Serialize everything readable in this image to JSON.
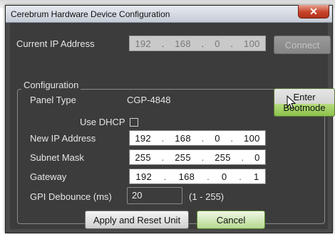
{
  "window": {
    "title": "Cerebrum Hardware Device Configuration"
  },
  "current_ip": {
    "label": "Current IP Address",
    "octets": [
      "192",
      "168",
      "0",
      "100"
    ],
    "connect_label": "Connect"
  },
  "configuration": {
    "group_title": "Configuration",
    "panel_type_label": "Panel Type",
    "panel_type_value": "CGP-4848",
    "enter_bootmode_line1": "Enter",
    "enter_bootmode_line2": "Bootmode",
    "use_dhcp_label": "Use DHCP",
    "use_dhcp_checked": false,
    "new_ip_label": "New IP Address",
    "new_ip_octets": [
      "192",
      "168",
      "0",
      "100"
    ],
    "subnet_label": "Subnet Mask",
    "subnet_octets": [
      "255",
      "255",
      "255",
      "0"
    ],
    "gateway_label": "Gateway",
    "gateway_octets": [
      "192",
      "168",
      "0",
      "1"
    ],
    "debounce_label": "GPI Debounce (ms)",
    "debounce_value": "20",
    "debounce_range": "(1 - 255)"
  },
  "buttons": {
    "apply_label": "Apply and Reset Unit",
    "cancel_label": "Cancel"
  },
  "icons": {
    "close": "close-icon",
    "cursor": "mouse-pointer-icon"
  },
  "colors": {
    "window_bg": "#3c3c3c",
    "title_bar": "#c5cbd6",
    "close_button": "#c8442a",
    "green_accent": "#8cc24a"
  }
}
